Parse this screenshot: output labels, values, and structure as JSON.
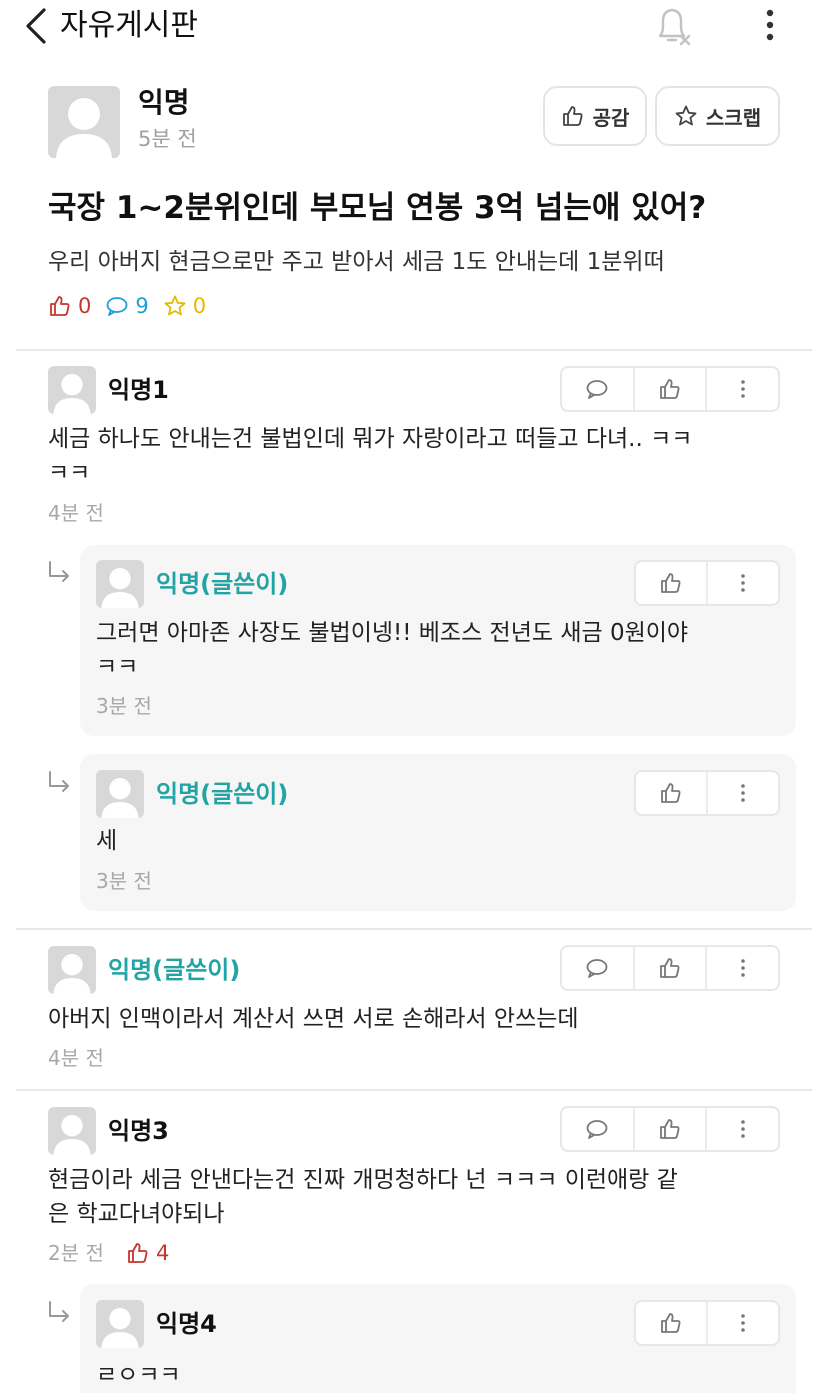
{
  "header": {
    "title": "자유게시판",
    "back_icon": "chevron-left-icon",
    "bell_icon": "bell-off-icon",
    "menu_icon": "kebab-menu-icon"
  },
  "post": {
    "author": "익명",
    "time": "5분 전",
    "like_button_label": "공감",
    "scrap_button_label": "스크랩",
    "title": "국장 1~2분위인데 부모님 연봉 3억 넘는애 있어?",
    "body": "우리 아버지 현금으로만 주고 받아서 세금 1도 안내는데 1분위떠",
    "likes": "0",
    "comments": "9",
    "scraps": "0"
  },
  "comments": [
    {
      "author": "익명1",
      "text_line1": "세금 하나도 안내는건 불법인데 뭐가 자랑이라고 떠들고 다녀.. ㅋㅋ",
      "text_line2": "ㅋㅋ",
      "time": "4분 전",
      "replies": [
        {
          "author": "익명(글쓴이)",
          "text_line1": "그러면 아마존 사장도 불법이넹!! 베조스 전년도 새금 0원이야",
          "text_line2": "ㅋㅋ",
          "time": "3분 전"
        },
        {
          "author": "익명(글쓴이)",
          "text_line1": "세",
          "time": "3분 전"
        }
      ]
    },
    {
      "author": "익명(글쓴이)",
      "text_line1": "아버지 인맥이라서 계산서 쓰면 서로 손해라서 안쓰는데",
      "time": "4분 전"
    },
    {
      "author": "익명3",
      "text_line1": "현금이라 세금 안낸다는건 진짜 개멍청하다 넌 ㅋㅋㅋ 이런애랑 같",
      "text_line2": "은 학교다녀야되나",
      "time": "2분 전",
      "likes": "4",
      "replies": [
        {
          "author": "익명4",
          "text_line1": "ㄹㅇㅋㅋ"
        }
      ]
    }
  ],
  "colors": {
    "op_author": "#23a4a4",
    "like": "#c4372c",
    "comment": "#1f9fd6",
    "scrap": "#e6b800"
  }
}
